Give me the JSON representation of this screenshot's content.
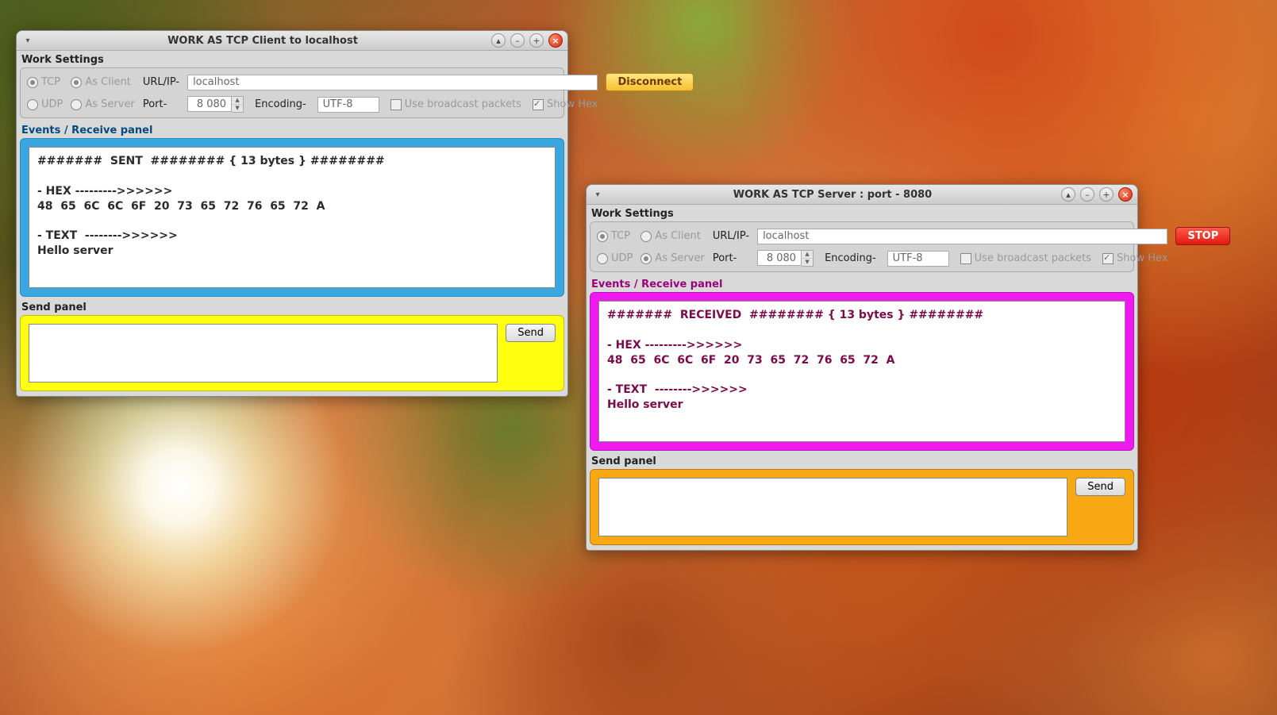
{
  "client": {
    "title": "WORK AS  TCP  Client to  localhost",
    "work_settings_label": "Work Settings",
    "proto": {
      "tcp": "TCP",
      "udp": "UDP"
    },
    "role": {
      "client": "As Client",
      "server": "As Server"
    },
    "url_label": "URL/IP-",
    "url_value": "localhost",
    "port_label": "Port-",
    "port_value": "8 080",
    "encoding_label": "Encoding-",
    "encoding_value": "UTF-8",
    "broadcast_label": "Use broadcast packets",
    "showhex_label": "Show Hex",
    "connect_btn": "Disconnect",
    "receive_label": "Events / Receive panel",
    "receive_text": "#######  SENT  ######## { 13 bytes } ########\n\n- HEX --------->>>>>>\n48  65  6C  6C  6F  20  73  65  72  76  65  72  A\n\n- TEXT  -------->>>>>>\nHello server",
    "send_label": "Send panel",
    "send_btn": "Send",
    "send_value": ""
  },
  "server": {
    "title": "WORK AS  TCP  Server  : port - 8080",
    "work_settings_label": "Work Settings",
    "proto": {
      "tcp": "TCP",
      "udp": "UDP"
    },
    "role": {
      "client": "As Client",
      "server": "As Server"
    },
    "url_label": "URL/IP-",
    "url_value": "localhost",
    "port_label": "Port-",
    "port_value": "8 080",
    "encoding_label": "Encoding-",
    "encoding_value": "UTF-8",
    "broadcast_label": "Use broadcast packets",
    "showhex_label": "Show Hex",
    "connect_btn": "STOP",
    "receive_label": "Events / Receive panel",
    "receive_text": "#######  RECEIVED  ######## { 13 bytes } ########\n\n- HEX --------->>>>>>\n48  65  6C  6C  6F  20  73  65  72  76  65  72  A\n\n- TEXT  -------->>>>>>\nHello server",
    "send_label": "Send panel",
    "send_btn": "Send",
    "send_value": ""
  }
}
